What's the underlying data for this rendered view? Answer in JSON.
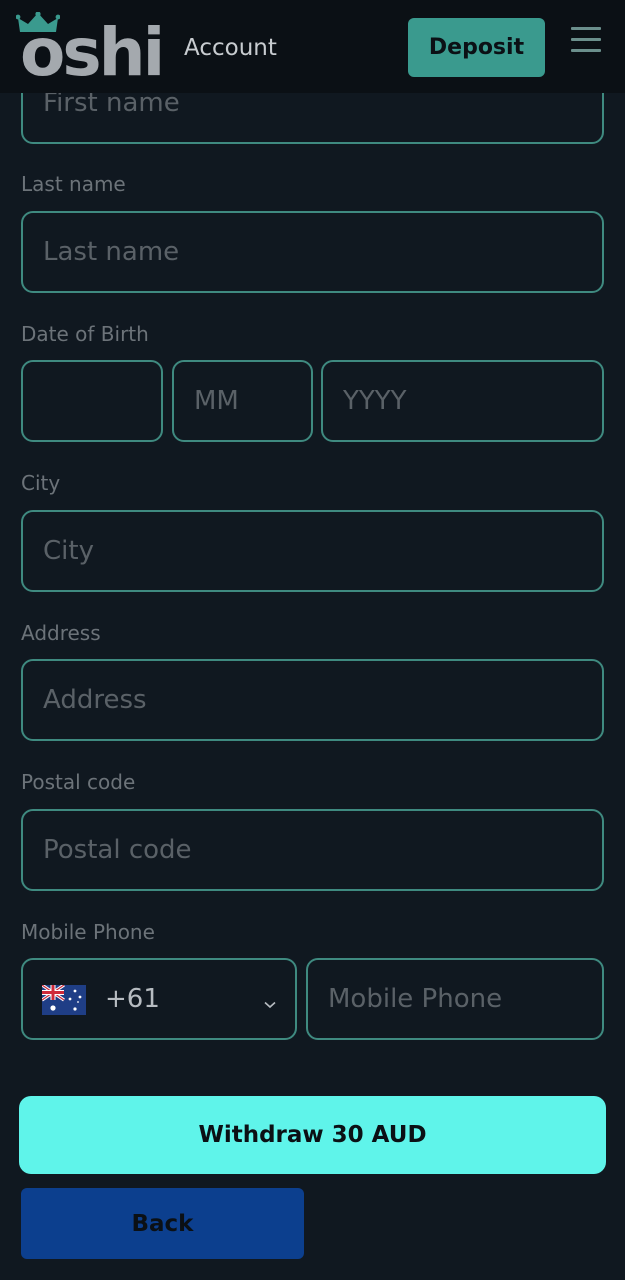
{
  "header": {
    "logo_text": "oshi",
    "title": "Account",
    "deposit_label": "Deposit",
    "menu_icon": "hamburger-menu-icon"
  },
  "form": {
    "first_name": {
      "placeholder": "First name"
    },
    "last_name": {
      "label": "Last name",
      "placeholder": "Last name"
    },
    "dob": {
      "label": "Date of Birth",
      "day_placeholder": "",
      "month_placeholder": "MM",
      "year_placeholder": "YYYY"
    },
    "city": {
      "label": "City",
      "placeholder": "City"
    },
    "address": {
      "label": "Address",
      "placeholder": "Address"
    },
    "postal_code": {
      "label": "Postal code",
      "placeholder": "Postal code"
    },
    "mobile_phone": {
      "label": "Mobile Phone",
      "country_flag": "australia-flag-icon",
      "country_code": "+61",
      "placeholder": "Mobile Phone"
    }
  },
  "actions": {
    "withdraw_label": "Withdraw 30 AUD",
    "back_label": "Back"
  },
  "colors": {
    "background": "#101820",
    "header_background": "#0b1015",
    "accent": "#3a9a8e",
    "field_border": "#3f8a80",
    "withdraw_button": "#5ff4ea",
    "back_button": "#0c3f8e"
  }
}
